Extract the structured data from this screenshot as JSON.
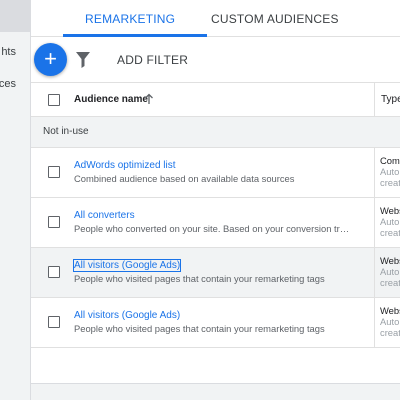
{
  "sidebar": {
    "items": [
      {
        "label": "hts"
      },
      {
        "label": "ces"
      }
    ]
  },
  "tabs": [
    {
      "label": "REMARKETING",
      "active": true
    },
    {
      "label": "CUSTOM AUDIENCES",
      "active": false
    }
  ],
  "toolbar": {
    "add_icon": "+",
    "add_filter_label": "ADD FILTER"
  },
  "table": {
    "columns": {
      "name": "Audience name",
      "type": "Type"
    },
    "group_label": "Not in-use",
    "rows": [
      {
        "name": "AdWords optimized list",
        "description": "Combined audience based on available data sources",
        "type_lines": [
          "Com",
          "Auto",
          "creat"
        ],
        "selected": false,
        "focused": false
      },
      {
        "name": "All converters",
        "description": "People who converted on your site. Based on your conversion trac...",
        "type_lines": [
          "Webs",
          "Auto",
          "creat"
        ],
        "selected": false,
        "focused": false
      },
      {
        "name": "All visitors (Google Ads)",
        "description": "People who visited pages that contain your remarketing tags",
        "type_lines": [
          "Webs",
          "Auto",
          "creat"
        ],
        "selected": true,
        "focused": true
      },
      {
        "name": "All visitors (Google Ads)",
        "description": "People who visited pages that contain your remarketing tags",
        "type_lines": [
          "Webs",
          "Auto",
          "creat"
        ],
        "selected": false,
        "focused": false
      }
    ]
  },
  "colors": {
    "accent": "#1a73e8",
    "text": "#202124",
    "muted": "#5f6368",
    "row_selected_bg": "#f1f3f4"
  }
}
